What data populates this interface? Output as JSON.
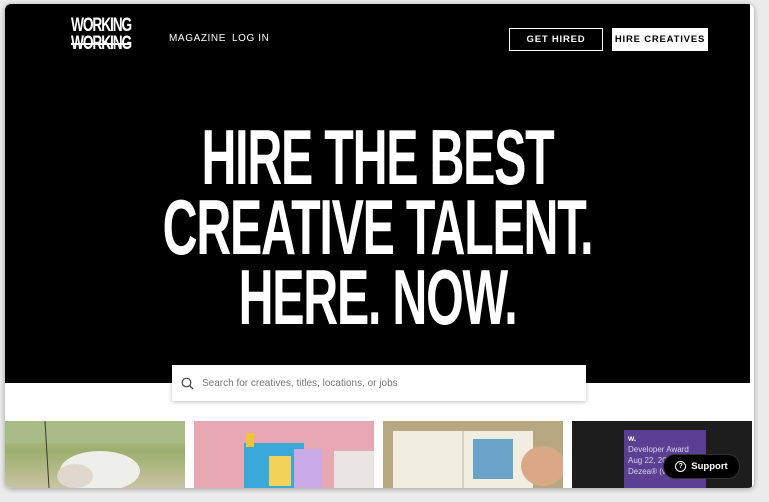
{
  "brand": {
    "logo_line1": "WORKING",
    "logo_line2": "WORKING"
  },
  "nav": {
    "magazine": "MAGAZINE",
    "login": "LOG IN"
  },
  "buttons": {
    "get_hired": "GET HIRED",
    "hire_creatives": "HIRE CREATIVES"
  },
  "hero": {
    "line1": "HIRE THE BEST",
    "line2": "CREATIVE TALENT.",
    "line3": "HERE. NOW."
  },
  "search": {
    "placeholder": "Search for creatives, titles, locations, or jobs",
    "value": ""
  },
  "thumbnails": {
    "t4": {
      "badge": "w.",
      "line1": "Developer Award",
      "line2": "Aug 22, 20",
      "line3": "Dezea® (v2"
    }
  },
  "support": {
    "label": "Support"
  },
  "colors": {
    "hero_bg": "#000000",
    "text_on_dark": "#ffffff",
    "award_purple": "#5b3f93"
  },
  "icons": {
    "search": "search-icon",
    "support": "question-circle-icon"
  }
}
